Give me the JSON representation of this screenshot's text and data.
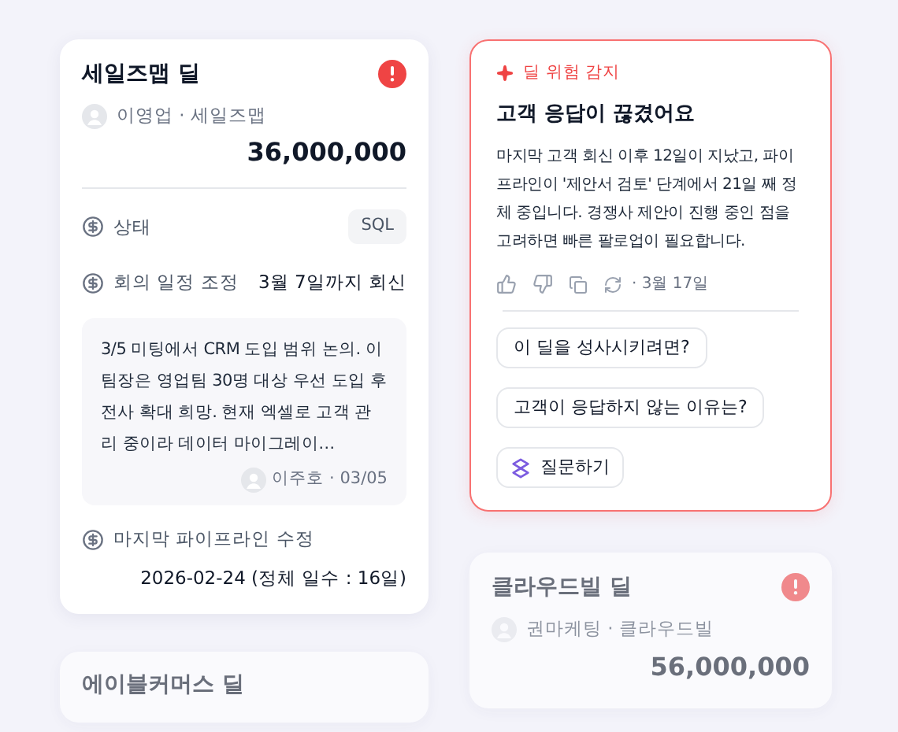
{
  "left_column": {
    "deals": [
      {
        "title": "세일즈맵 딜",
        "alert": true,
        "dimmed": false,
        "owner_line": "이영업 · 세일즈맵",
        "amount": "36,000,000",
        "rows": [
          {
            "kind": "badge",
            "label": "상태",
            "value": "SQL"
          },
          {
            "kind": "text",
            "label": "회의 일정 조정",
            "value": "3월 7일까지 회신"
          }
        ],
        "note": {
          "text": "3/5 미팅에서 CRM 도입 범위 논의. 이 팀장은 영업팀 30명 대상 우선 도입 후 전사 확대 희망. 현재 엑셀로 고객 관리 중이라 데이터 마이그레이…",
          "meta": "이주호 · 03/05"
        },
        "footer": {
          "label": "마지막 파이프라인 수정",
          "value": "2026-02-24 (정체 일수 : 16일)"
        }
      },
      {
        "title": "에이블커머스 딜",
        "alert": false,
        "dimmed": true
      }
    ]
  },
  "right_column": {
    "insight": {
      "tag": "딜 위험 감지",
      "title": "고객 응답이 끊겼어요",
      "body": "마지막 고객 회신 이후 12일이 지났고, 파이프라인이 '제안서 검토' 단계에서 21일 째 정체 중입니다. 경쟁사 제안이 진행 중인 점을 고려하면 빠른 팔로업이 필요합니다.",
      "date": "· 3월 17일",
      "suggestions": [
        "이 딜을 성사시키려면?",
        "고객이 응답하지 않는 이유는?"
      ],
      "ask_button": "질문하기"
    },
    "deals": [
      {
        "title": "클라우드빌 딜",
        "alert": true,
        "dimmed": true,
        "owner_line": "권마케팅 · 클라우드빌",
        "amount": "56,000,000"
      }
    ]
  }
}
